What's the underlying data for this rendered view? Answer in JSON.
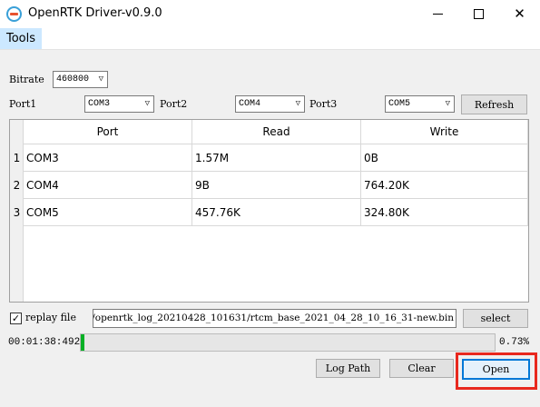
{
  "window": {
    "title": "OpenRTK Driver-v0.9.0"
  },
  "menu": {
    "tools": "Tools"
  },
  "bitrate": {
    "label": "Bitrate",
    "value": "460800"
  },
  "ports": [
    {
      "label": "Port1",
      "value": "COM3"
    },
    {
      "label": "Port2",
      "value": "COM4"
    },
    {
      "label": "Port3",
      "value": "COM5"
    }
  ],
  "refresh_label": "Refresh",
  "table": {
    "headers": [
      "Port",
      "Read",
      "Write"
    ],
    "rows": [
      {
        "num": "1",
        "port": "COM3",
        "read": "1.57M",
        "write": "0B"
      },
      {
        "num": "2",
        "port": "COM4",
        "read": "9B",
        "write": "764.20K"
      },
      {
        "num": "3",
        "port": "COM5",
        "read": "457.76K",
        "write": "324.80K"
      }
    ]
  },
  "replay": {
    "label": "replay file",
    "checked": true,
    "path": "/openrtk_log_20210428_101631/rtcm_base_2021_04_28_10_16_31-new.bin",
    "select_label": "select"
  },
  "progress": {
    "elapsed": "00:01:38:492",
    "percent_text": "0.73%",
    "fraction": 0.0073
  },
  "buttons": {
    "log_path": "Log Path",
    "clear": "Clear",
    "open": "Open"
  },
  "colors": {
    "progress": "#06b025",
    "highlight": "#e8281e",
    "menu_hover": "#cce8ff"
  }
}
